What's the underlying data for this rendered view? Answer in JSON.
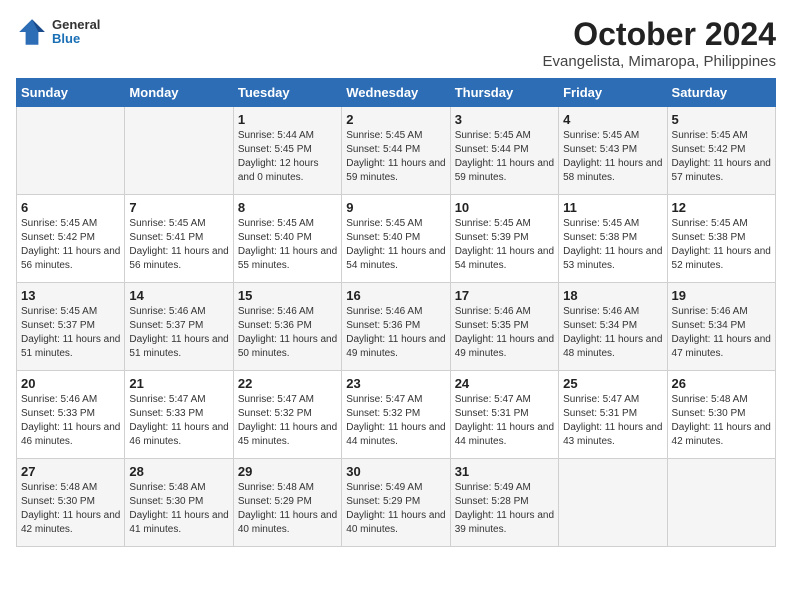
{
  "logo": {
    "general": "General",
    "blue": "Blue"
  },
  "title": "October 2024",
  "subtitle": "Evangelista, Mimaropa, Philippines",
  "days_of_week": [
    "Sunday",
    "Monday",
    "Tuesday",
    "Wednesday",
    "Thursday",
    "Friday",
    "Saturday"
  ],
  "weeks": [
    [
      {
        "day": "",
        "info": ""
      },
      {
        "day": "",
        "info": ""
      },
      {
        "day": "1",
        "info": "Sunrise: 5:44 AM\nSunset: 5:45 PM\nDaylight: 12 hours and 0 minutes."
      },
      {
        "day": "2",
        "info": "Sunrise: 5:45 AM\nSunset: 5:44 PM\nDaylight: 11 hours and 59 minutes."
      },
      {
        "day": "3",
        "info": "Sunrise: 5:45 AM\nSunset: 5:44 PM\nDaylight: 11 hours and 59 minutes."
      },
      {
        "day": "4",
        "info": "Sunrise: 5:45 AM\nSunset: 5:43 PM\nDaylight: 11 hours and 58 minutes."
      },
      {
        "day": "5",
        "info": "Sunrise: 5:45 AM\nSunset: 5:42 PM\nDaylight: 11 hours and 57 minutes."
      }
    ],
    [
      {
        "day": "6",
        "info": "Sunrise: 5:45 AM\nSunset: 5:42 PM\nDaylight: 11 hours and 56 minutes."
      },
      {
        "day": "7",
        "info": "Sunrise: 5:45 AM\nSunset: 5:41 PM\nDaylight: 11 hours and 56 minutes."
      },
      {
        "day": "8",
        "info": "Sunrise: 5:45 AM\nSunset: 5:40 PM\nDaylight: 11 hours and 55 minutes."
      },
      {
        "day": "9",
        "info": "Sunrise: 5:45 AM\nSunset: 5:40 PM\nDaylight: 11 hours and 54 minutes."
      },
      {
        "day": "10",
        "info": "Sunrise: 5:45 AM\nSunset: 5:39 PM\nDaylight: 11 hours and 54 minutes."
      },
      {
        "day": "11",
        "info": "Sunrise: 5:45 AM\nSunset: 5:38 PM\nDaylight: 11 hours and 53 minutes."
      },
      {
        "day": "12",
        "info": "Sunrise: 5:45 AM\nSunset: 5:38 PM\nDaylight: 11 hours and 52 minutes."
      }
    ],
    [
      {
        "day": "13",
        "info": "Sunrise: 5:45 AM\nSunset: 5:37 PM\nDaylight: 11 hours and 51 minutes."
      },
      {
        "day": "14",
        "info": "Sunrise: 5:46 AM\nSunset: 5:37 PM\nDaylight: 11 hours and 51 minutes."
      },
      {
        "day": "15",
        "info": "Sunrise: 5:46 AM\nSunset: 5:36 PM\nDaylight: 11 hours and 50 minutes."
      },
      {
        "day": "16",
        "info": "Sunrise: 5:46 AM\nSunset: 5:36 PM\nDaylight: 11 hours and 49 minutes."
      },
      {
        "day": "17",
        "info": "Sunrise: 5:46 AM\nSunset: 5:35 PM\nDaylight: 11 hours and 49 minutes."
      },
      {
        "day": "18",
        "info": "Sunrise: 5:46 AM\nSunset: 5:34 PM\nDaylight: 11 hours and 48 minutes."
      },
      {
        "day": "19",
        "info": "Sunrise: 5:46 AM\nSunset: 5:34 PM\nDaylight: 11 hours and 47 minutes."
      }
    ],
    [
      {
        "day": "20",
        "info": "Sunrise: 5:46 AM\nSunset: 5:33 PM\nDaylight: 11 hours and 46 minutes."
      },
      {
        "day": "21",
        "info": "Sunrise: 5:47 AM\nSunset: 5:33 PM\nDaylight: 11 hours and 46 minutes."
      },
      {
        "day": "22",
        "info": "Sunrise: 5:47 AM\nSunset: 5:32 PM\nDaylight: 11 hours and 45 minutes."
      },
      {
        "day": "23",
        "info": "Sunrise: 5:47 AM\nSunset: 5:32 PM\nDaylight: 11 hours and 44 minutes."
      },
      {
        "day": "24",
        "info": "Sunrise: 5:47 AM\nSunset: 5:31 PM\nDaylight: 11 hours and 44 minutes."
      },
      {
        "day": "25",
        "info": "Sunrise: 5:47 AM\nSunset: 5:31 PM\nDaylight: 11 hours and 43 minutes."
      },
      {
        "day": "26",
        "info": "Sunrise: 5:48 AM\nSunset: 5:30 PM\nDaylight: 11 hours and 42 minutes."
      }
    ],
    [
      {
        "day": "27",
        "info": "Sunrise: 5:48 AM\nSunset: 5:30 PM\nDaylight: 11 hours and 42 minutes."
      },
      {
        "day": "28",
        "info": "Sunrise: 5:48 AM\nSunset: 5:30 PM\nDaylight: 11 hours and 41 minutes."
      },
      {
        "day": "29",
        "info": "Sunrise: 5:48 AM\nSunset: 5:29 PM\nDaylight: 11 hours and 40 minutes."
      },
      {
        "day": "30",
        "info": "Sunrise: 5:49 AM\nSunset: 5:29 PM\nDaylight: 11 hours and 40 minutes."
      },
      {
        "day": "31",
        "info": "Sunrise: 5:49 AM\nSunset: 5:28 PM\nDaylight: 11 hours and 39 minutes."
      },
      {
        "day": "",
        "info": ""
      },
      {
        "day": "",
        "info": ""
      }
    ]
  ]
}
